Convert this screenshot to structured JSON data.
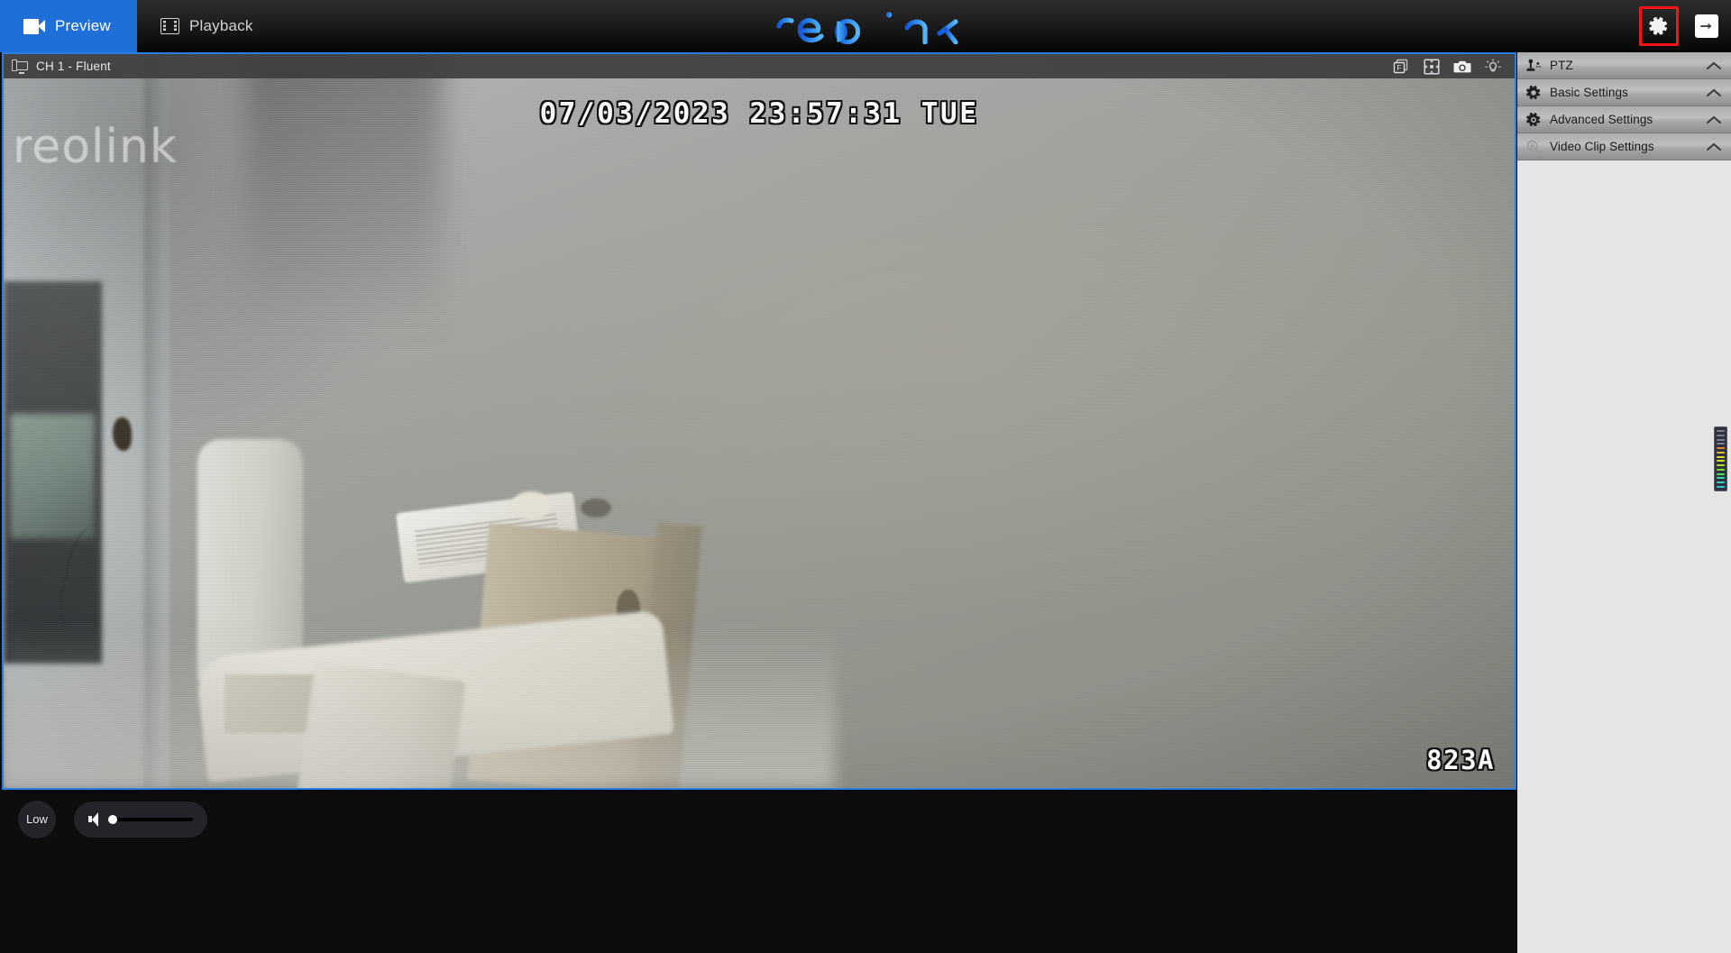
{
  "app": {
    "brand": "reolink",
    "brand_color_dark": "#1a62d8",
    "brand_color_light": "#49a9f2",
    "accent_blue": "#1e70d8",
    "highlight_red": "#f41616"
  },
  "header": {
    "tabs": [
      {
        "label": "Preview",
        "icon": "camcorder-icon",
        "active": true
      },
      {
        "label": "Playback",
        "icon": "filmstrip-icon",
        "active": false
      }
    ],
    "actions": [
      {
        "name": "settings-button",
        "icon": "gear-icon",
        "highlighted": true
      },
      {
        "name": "exit-button",
        "icon": "exit-arrow-icon",
        "highlighted": false
      }
    ]
  },
  "video": {
    "channel_label": "CH 1 - Fluent",
    "channel_icon": "monitor-icon",
    "overlay_timestamp": "07/03/2023  23:57:31  TUE",
    "overlay_camera_name": "823A",
    "watermark": "reolink",
    "toolbar_icons": [
      {
        "name": "fluent-stream-icon",
        "glyph": "F"
      },
      {
        "name": "fullscreen-icon",
        "glyph": "expand"
      },
      {
        "name": "snapshot-icon",
        "glyph": "camera"
      },
      {
        "name": "floodlight-icon",
        "glyph": "bulb"
      }
    ]
  },
  "bottom_bar": {
    "quality_label": "Low",
    "volume_icon": "speaker-icon",
    "volume_value": 0
  },
  "sidebar": {
    "items": [
      {
        "label": "PTZ",
        "icon": "ptz-joystick-icon",
        "expand_icon": "chevron-up-icon"
      },
      {
        "label": "Basic Settings",
        "icon": "gear-icon",
        "expand_icon": "chevron-up-icon"
      },
      {
        "label": "Advanced Settings",
        "icon": "gear-filled-icon",
        "expand_icon": "chevron-up-icon"
      },
      {
        "label": "Video Clip Settings",
        "icon": "zoom-in-icon",
        "expand_icon": "chevron-up-icon"
      }
    ]
  },
  "level_meter": {
    "name": "signal-level-meter",
    "segments": [
      "#7a8090",
      "#7a8090",
      "#7a8090",
      "#7a8090",
      "#e08a2a",
      "#e0c22a",
      "#e0d82a",
      "#d8e02a",
      "#b6e02a",
      "#7ee02a",
      "#4ae05a",
      "#3ad8a0",
      "#35cfc0",
      "#35c6d0"
    ]
  }
}
